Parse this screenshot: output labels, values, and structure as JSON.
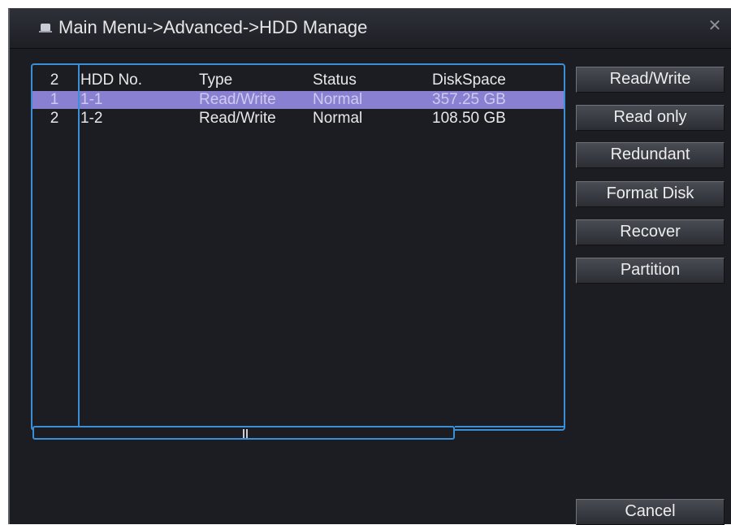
{
  "window": {
    "title": "Main Menu->Advanced->HDD Manage",
    "icon": "monitor-icon",
    "close_glyph": "✕"
  },
  "table": {
    "headers": {
      "index": "2",
      "hdd_no": "HDD No.",
      "type": "Type",
      "status": "Status",
      "disk_space": "DiskSpace"
    },
    "rows": [
      {
        "index": "1",
        "hdd_no": "1-1",
        "type": "Read/Write",
        "status": "Normal",
        "disk_space": "357.25 GB",
        "selected": true
      },
      {
        "index": "2",
        "hdd_no": "1-2",
        "type": "Read/Write",
        "status": "Normal",
        "disk_space": "108.50 GB",
        "selected": false
      }
    ]
  },
  "actions": {
    "read_write": "Read/Write",
    "read_only": "Read only",
    "redundant": "Redundant",
    "format_disk": "Format Disk",
    "recover": "Recover",
    "partition": "Partition",
    "cancel": "Cancel"
  },
  "colors": {
    "accent_border": "#3b8fd6",
    "selected_row": "#8a80d2",
    "background": "#1c1d22"
  }
}
